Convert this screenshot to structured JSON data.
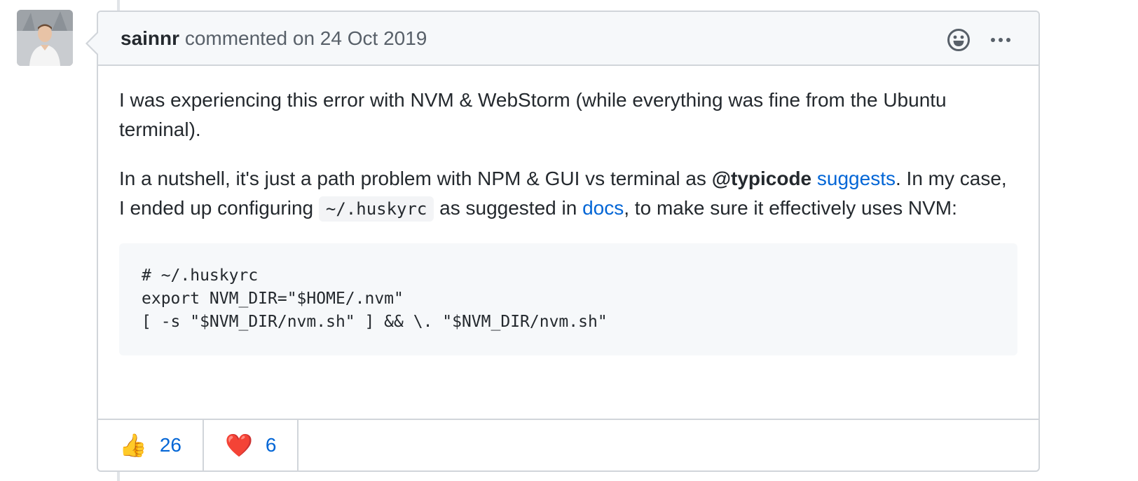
{
  "comment": {
    "author": "sainnr",
    "meta": "commented on 24 Oct 2019",
    "body": {
      "p1": "I was experiencing this error with NVM & WebStorm (while everything was fine from the Ubuntu terminal).",
      "p2_part1": "In a nutshell, it's just a path problem with NPM & GUI vs terminal as ",
      "p2_mention": "@typicode",
      "p2_link": "suggests",
      "p2_part2": ". In my case, I ended up configuring ",
      "p2_code": "~/.huskyrc",
      "p2_part3": " as suggested in ",
      "p2_docs_link": "docs",
      "p2_part4": ", to make sure it effectively uses NVM:"
    },
    "code_block": {
      "line1": "# ~/.huskyrc",
      "line2": "export NVM_DIR=\"$HOME/.nvm\"",
      "line3": "[ -s \"$NVM_DIR/nvm.sh\" ] && \\. \"$NVM_DIR/nvm.sh\""
    },
    "reactions": [
      {
        "emoji": "👍",
        "count": "26"
      },
      {
        "emoji": "❤️",
        "count": "6"
      }
    ]
  },
  "icons": {
    "add_reaction": "smiley-icon",
    "more_actions": "kebab-horizontal-icon"
  }
}
